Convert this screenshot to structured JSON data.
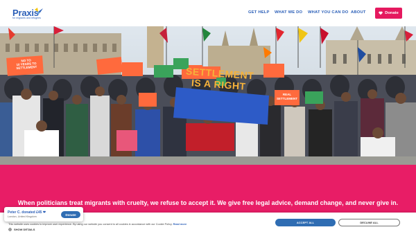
{
  "header": {
    "logo_name": "Praxis",
    "logo_tagline": "for migrants and refugees",
    "nav": [
      "GET HELP",
      "WHAT WE DO",
      "WHAT YOU CAN DO",
      "ABOUT"
    ],
    "donate_label": "Donate",
    "donate_icon": "heart-icon"
  },
  "hero": {
    "banner_main_line1": "SETTLEMENT",
    "banner_main_line2": "IS A RIGHT",
    "placard_left": [
      "NO TO",
      "10 YEARS TO",
      "SETTLEMENT"
    ],
    "placard_right": [
      "REAL",
      "SETTLEMENT"
    ]
  },
  "mission": {
    "text": "When politicians treat migrants with cruelty, we refuse to accept it. We give free legal advice, demand change, and never give in."
  },
  "donation_toast": {
    "title": "Peter C. donated £45 ❤",
    "location": "London, United Kingdom",
    "button": "Donate"
  },
  "cookie_banner": {
    "text": "This website uses cookies to improve user experience. By using our website you consent to all cookies in accordance with our Cookie Policy.",
    "read_more": "Read more",
    "show_details": "SHOW DETAILS",
    "accept_label": "ACCEPT ALL",
    "decline_label": "DECLINE ALL"
  },
  "colors": {
    "brand_blue": "#2b5fb8",
    "brand_pink": "#e81d66",
    "donate_pink": "#e5195f",
    "button_blue": "#2f6db3"
  }
}
